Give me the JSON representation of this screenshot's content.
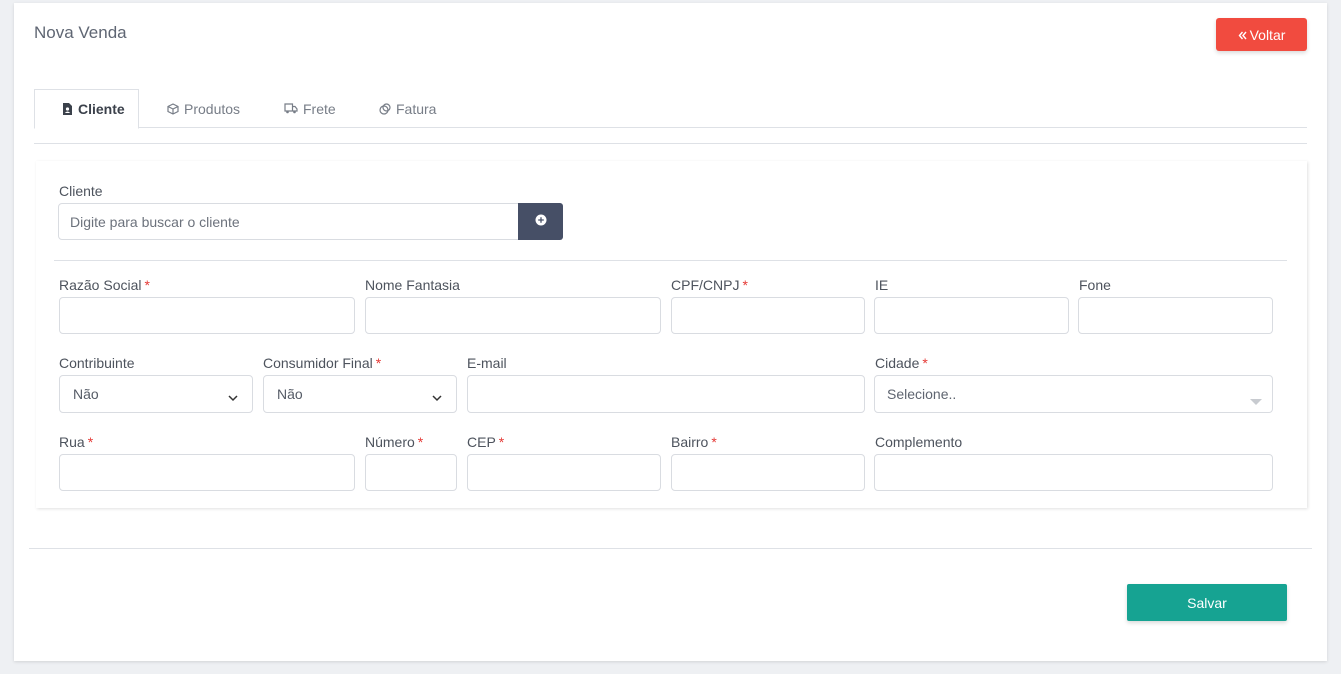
{
  "page": {
    "title": "Nova Venda"
  },
  "header": {
    "back_label": "Voltar"
  },
  "tabs": [
    {
      "label": "Cliente",
      "icon": "file-user-icon",
      "active": true
    },
    {
      "label": "Produtos",
      "icon": "box-icon",
      "active": false
    },
    {
      "label": "Frete",
      "icon": "truck-icon",
      "active": false
    },
    {
      "label": "Fatura",
      "icon": "coins-icon",
      "active": false
    }
  ],
  "form": {
    "client_search": {
      "label": "Cliente",
      "placeholder": "Digite para buscar o cliente"
    },
    "razao_social": {
      "label": "Razão Social",
      "required": "*"
    },
    "nome_fantasia": {
      "label": "Nome Fantasia"
    },
    "cpf_cnpj": {
      "label": "CPF/CNPJ",
      "required": "*"
    },
    "ie": {
      "label": "IE"
    },
    "fone": {
      "label": "Fone"
    },
    "contribuinte": {
      "label": "Contribuinte",
      "value": "Não"
    },
    "consumidor_final": {
      "label": "Consumidor Final",
      "required": "*",
      "value": "Não"
    },
    "email": {
      "label": "E-mail"
    },
    "cidade": {
      "label": "Cidade",
      "required": "*",
      "value": "Selecione.."
    },
    "rua": {
      "label": "Rua",
      "required": "*"
    },
    "numero": {
      "label": "Número",
      "required": "*"
    },
    "cep": {
      "label": "CEP",
      "required": "*"
    },
    "bairro": {
      "label": "Bairro",
      "required": "*"
    },
    "complemento": {
      "label": "Complemento"
    }
  },
  "footer": {
    "save_label": "Salvar"
  },
  "colors": {
    "back_button": "#f14b3f",
    "save_button": "#16a392",
    "search_button": "#464f66",
    "required": "#e53935"
  }
}
